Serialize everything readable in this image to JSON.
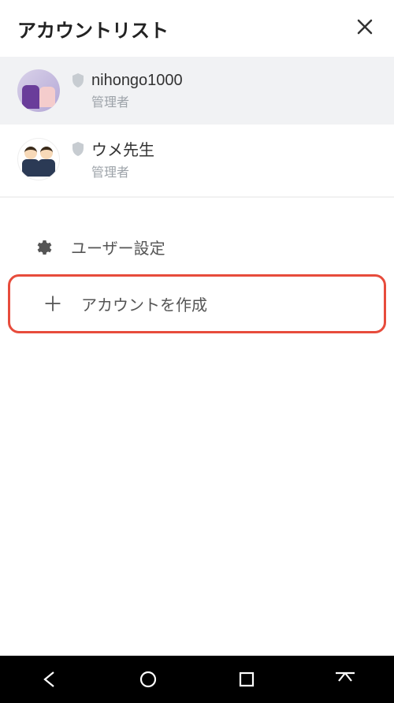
{
  "header": {
    "title": "アカウントリスト"
  },
  "accounts": [
    {
      "name": "nihongo1000",
      "role": "管理者"
    },
    {
      "name": "ウメ先生",
      "role": "管理者"
    }
  ],
  "menu": {
    "user_settings": "ユーザー設定",
    "create_account": "アカウントを作成"
  }
}
